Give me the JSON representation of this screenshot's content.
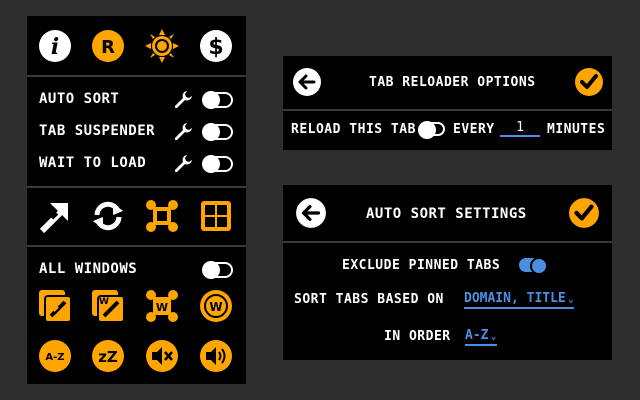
{
  "left_panel": {
    "top_icons": [
      "info-icon",
      "r-icon",
      "sun-icon",
      "dollar-icon"
    ],
    "rows": [
      {
        "label": "AUTO SORT"
      },
      {
        "label": "TAB SUSPENDER"
      },
      {
        "label": "WAIT TO LOAD"
      }
    ],
    "action_icons": [
      "link-arrow-icon",
      "refresh-icon",
      "scatter-icon",
      "grid-icon"
    ],
    "all_windows_label": "ALL WINDOWS",
    "bottom_icons_row1": [
      "link-box-icon",
      "link-box-alt-icon",
      "w-scatter-icon",
      "w-circle-icon"
    ],
    "bottom_icons_row2": [
      "az-icon",
      "sleep-icon",
      "mute-icon",
      "volume-icon"
    ],
    "az_text": "A-Z",
    "zz_text": "zZ",
    "r_text": "R",
    "i_text": "i",
    "dollar_text": "$",
    "w_text": "W"
  },
  "reloader": {
    "title": "TAB RELOADER OPTIONS",
    "reload_label": "RELOAD THIS TAB",
    "every_label": "EVERY",
    "interval_value": "1",
    "minutes_label": "MINUTES"
  },
  "autosort": {
    "title": "AUTO SORT SETTINGS",
    "exclude_label": "EXCLUDE PINNED TABS",
    "sort_based_label": "SORT TABS BASED ON",
    "sort_based_value": "DOMAIN, TITLE",
    "order_label": "IN ORDER",
    "order_value": "A-Z"
  },
  "colors": {
    "accent": "#ffa500",
    "toggle_on": "#4a90e2",
    "panel_bg": "#000000",
    "page_bg": "#2e2e2e"
  }
}
